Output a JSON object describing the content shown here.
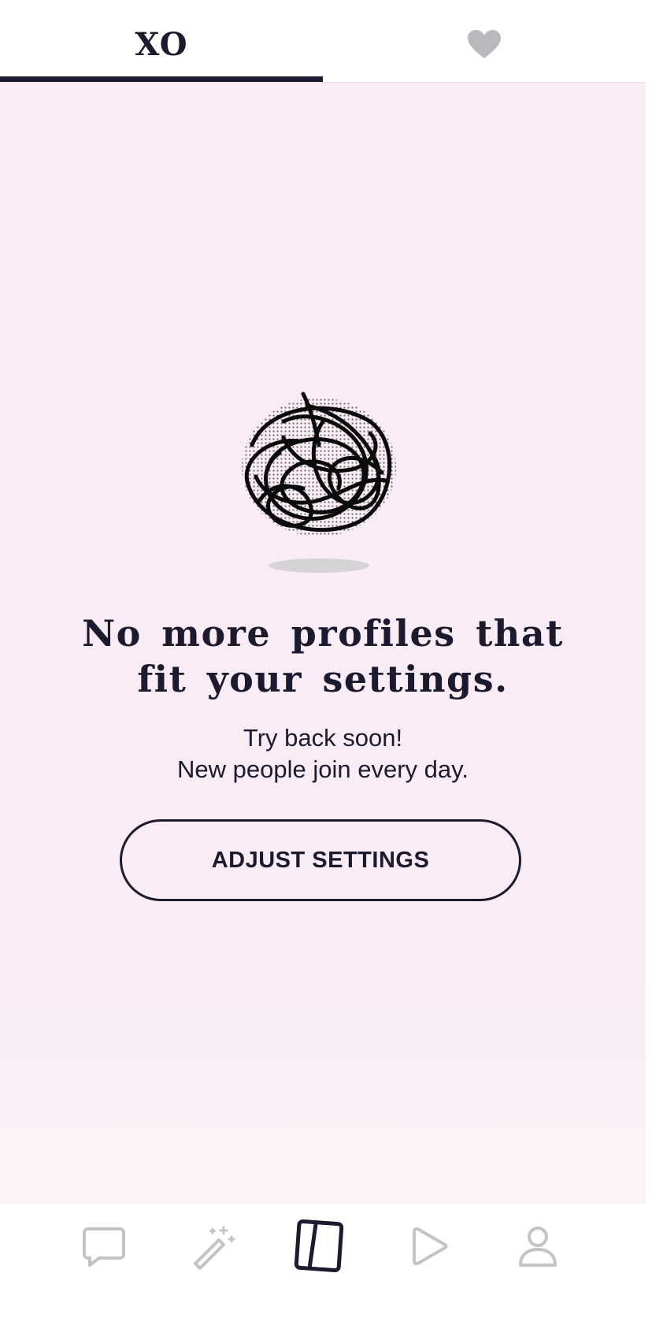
{
  "top_tabs": [
    {
      "label": "XO",
      "selected": true
    },
    {
      "icon": "heart-icon",
      "selected": false
    }
  ],
  "empty_state": {
    "illustration": "tangled-scribble-ball",
    "headline": "No more profiles that fit your settings.",
    "subtext_line1": "Try back soon!",
    "subtext_line2": "New people join every day.",
    "button_label": "ADJUST SETTINGS"
  },
  "bottom_nav": [
    {
      "icon": "chat-icon",
      "selected": false
    },
    {
      "icon": "magic-wand-icon",
      "selected": false
    },
    {
      "icon": "cards-icon",
      "selected": true
    },
    {
      "icon": "play-icon",
      "selected": false
    },
    {
      "icon": "person-icon",
      "selected": false
    }
  ],
  "colors": {
    "background": "#f9ecf5",
    "primary_text": "#1b1a2e",
    "inactive_icon": "#c4c4c8"
  }
}
